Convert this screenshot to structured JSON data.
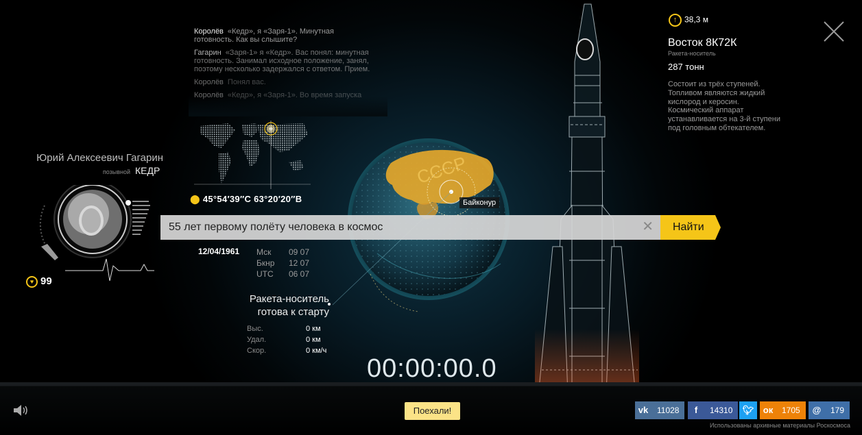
{
  "dialog": [
    {
      "speaker": "Королёв",
      "text": "«Кедр», я «Заря-1». Минутная готовность. Как вы слышите?"
    },
    {
      "speaker": "Гагарин",
      "text": "«Заря-1» я «Кедр». Вас понял: минутная готовность. Занимал исходное положение, занял, поэтому несколько задержался с ответом. Прием."
    },
    {
      "speaker": "Королёв",
      "text": "Понял вас."
    },
    {
      "speaker": "Королёв",
      "text": "«Кедр», я «Заря-1». Во время запуска"
    }
  ],
  "location": {
    "coords": "45°54′39″С  63°20′20″В",
    "site_label": "Байконур"
  },
  "pilot": {
    "name": "Юрий Алексеевич Гагарин",
    "callsign_label": "позывной",
    "callsign": "КЕДР",
    "pulse": "99"
  },
  "search": {
    "value": "55 лет первому полёту человека в космос",
    "clear": "✕",
    "button": "Найти"
  },
  "launch": {
    "date": "12/04/1961",
    "zones": [
      "Мск",
      "Бкнр",
      "UTC"
    ],
    "times": [
      "09 07",
      "12 07",
      "06 07"
    ]
  },
  "status": {
    "line1": "Ракета-носитель",
    "line2": "готова к старту"
  },
  "stats": [
    {
      "label": "Выс.",
      "value": "0 км"
    },
    {
      "label": "Удал.",
      "value": "0 км"
    },
    {
      "label": "Скор.",
      "value": "0 км/ч"
    }
  ],
  "timer": "00:00:00.0",
  "rocket": {
    "height": "38,3 м",
    "name": "Восток 8К72К",
    "type": "Ракета-носитель",
    "mass": "287 тонн",
    "description": "Состоит из трёх ступеней. Топливом являются жидкий кислород и керосин. Космический аппарат устанавливается на 3-й ступени под головным обтекателем."
  },
  "go_button": "Поехали!",
  "share": {
    "vk": "11028",
    "fb": "14310",
    "ok": "1705",
    "mm": "179"
  },
  "credits": "Использованы архивные материалы Роскосмоса",
  "colors": {
    "accent": "#f5c518",
    "go": "#fbe387",
    "vk": "#4a6f98",
    "fb": "#3b5998",
    "tw": "#1da1f2",
    "ok": "#ee8208",
    "mm": "#3f6fa8"
  },
  "icons": [
    "sound-icon",
    "close-icon",
    "pin-icon",
    "heart-icon",
    "height-arrow-icon"
  ]
}
